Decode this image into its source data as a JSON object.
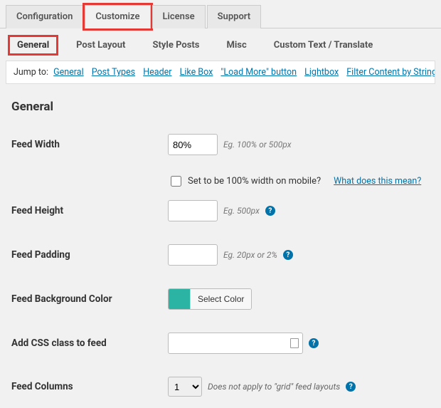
{
  "top_tabs": {
    "configuration": "Configuration",
    "customize": "Customize",
    "license": "License",
    "support": "Support"
  },
  "sub_tabs": {
    "general": "General",
    "post_layout": "Post Layout",
    "style_posts": "Style Posts",
    "misc": "Misc",
    "custom_text": "Custom Text / Translate"
  },
  "jump": {
    "label": "Jump to:",
    "links": {
      "general": "General",
      "post_types": "Post Types",
      "header": "Header",
      "like_box": "Like Box",
      "load_more": "\"Load More\" button",
      "lightbox": "Lightbox",
      "filter": "Filter Content by String"
    }
  },
  "section_title": "General",
  "fields": {
    "feed_width": {
      "label": "Feed Width",
      "value": "80%",
      "hint": "Eg. 100% or 500px"
    },
    "mobile_width": {
      "label": "Set to be 100% width on mobile?",
      "link": "What does this mean?"
    },
    "feed_height": {
      "label": "Feed Height",
      "value": "",
      "hint": "Eg. 500px"
    },
    "feed_padding": {
      "label": "Feed Padding",
      "value": "",
      "hint": "Eg. 20px or 2%"
    },
    "bg_color": {
      "label": "Feed Background Color",
      "button": "Select Color",
      "swatch": "#2bb3a3"
    },
    "css_class": {
      "label": "Add CSS class to feed",
      "value": ""
    },
    "columns": {
      "label": "Feed Columns",
      "value": "1",
      "hint": "Does not apply to \"grid\" feed layouts"
    }
  }
}
